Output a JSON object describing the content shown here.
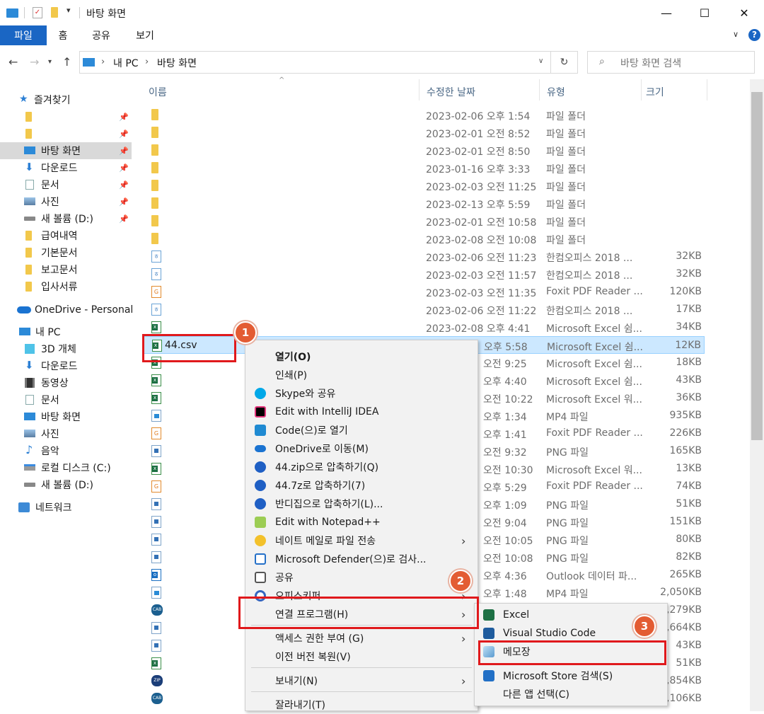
{
  "window": {
    "title": "바탕 화면",
    "controls": {
      "minimize": "—",
      "maximize": "☐",
      "close": "✕"
    }
  },
  "ribbon": {
    "tabs": [
      {
        "label": "파일",
        "active": true
      },
      {
        "label": "홈"
      },
      {
        "label": "공유"
      },
      {
        "label": "보기"
      }
    ],
    "help": "?"
  },
  "address": {
    "path": [
      "내 PC",
      "바탕 화면"
    ],
    "search_placeholder": "바탕 화면 검색"
  },
  "sidebar": {
    "quick_access": "즐겨찾기",
    "items": [
      {
        "label": "",
        "icon": "folder-icon",
        "pinned": true
      },
      {
        "label": "",
        "icon": "folder-icon",
        "pinned": true
      },
      {
        "label": "바탕 화면",
        "icon": "desktop-icon",
        "pinned": true,
        "selected": true
      },
      {
        "label": "다운로드",
        "icon": "download-icon",
        "pinned": true
      },
      {
        "label": "문서",
        "icon": "document-icon",
        "pinned": true
      },
      {
        "label": "사진",
        "icon": "pictures-icon",
        "pinned": true
      },
      {
        "label": "새 볼륨 (D:)",
        "icon": "drive-icon",
        "pinned": true
      },
      {
        "label": "급여내역",
        "icon": "folder-icon"
      },
      {
        "label": "기본문서",
        "icon": "folder-icon"
      },
      {
        "label": "보고문서",
        "icon": "folder-icon"
      },
      {
        "label": "입사서류",
        "icon": "folder-icon"
      }
    ],
    "onedrive": "OneDrive - Personal",
    "this_pc": "내 PC",
    "pc_items": [
      {
        "label": "3D 개체",
        "icon": "3d-objects-icon"
      },
      {
        "label": "다운로드",
        "icon": "download-icon"
      },
      {
        "label": "동영상",
        "icon": "video-icon"
      },
      {
        "label": "문서",
        "icon": "document-icon"
      },
      {
        "label": "바탕 화면",
        "icon": "desktop-icon"
      },
      {
        "label": "사진",
        "icon": "pictures-icon"
      },
      {
        "label": "음악",
        "icon": "music-icon"
      },
      {
        "label": "로컬 디스크 (C:)",
        "icon": "local-disk-icon"
      },
      {
        "label": "새 볼륨 (D:)",
        "icon": "drive-icon"
      }
    ],
    "network": "네트워크"
  },
  "filelist": {
    "columns": {
      "name": "이름",
      "date": "수정한 날짜",
      "type": "유형",
      "size": "크기"
    },
    "rows": [
      {
        "icon": "folder",
        "name": "",
        "date": "2023-02-06 오후 1:54",
        "type": "파일 폴더",
        "size": ""
      },
      {
        "icon": "folder",
        "name": "",
        "date": "2023-02-01 오전 8:52",
        "type": "파일 폴더",
        "size": ""
      },
      {
        "icon": "folder",
        "name": "",
        "date": "2023-02-01 오전 8:50",
        "type": "파일 폴더",
        "size": ""
      },
      {
        "icon": "folder",
        "name": "",
        "date": "2023-01-16 오후 3:33",
        "type": "파일 폴더",
        "size": ""
      },
      {
        "icon": "folder",
        "name": "",
        "date": "2023-02-03 오전 11:25",
        "type": "파일 폴더",
        "size": ""
      },
      {
        "icon": "folder",
        "name": "",
        "date": "2023-02-13 오후 5:59",
        "type": "파일 폴더",
        "size": ""
      },
      {
        "icon": "folder",
        "name": "",
        "date": "2023-02-01 오전 10:58",
        "type": "파일 폴더",
        "size": ""
      },
      {
        "icon": "folder",
        "name": "",
        "date": "2023-02-08 오전 10:08",
        "type": "파일 폴더",
        "size": ""
      },
      {
        "icon": "hwp",
        "name": "",
        "date": "2023-02-06 오전 11:23",
        "type": "한컴오피스 2018 ...",
        "size": "32KB"
      },
      {
        "icon": "hwp",
        "name": "",
        "date": "2023-02-03 오전 11:57",
        "type": "한컴오피스 2018 ...",
        "size": "32KB"
      },
      {
        "icon": "pdf",
        "name": "",
        "date": "2023-02-03 오전 11:35",
        "type": "Foxit PDF Reader ...",
        "size": "120KB"
      },
      {
        "icon": "hwp",
        "name": "",
        "date": "2023-02-06 오전 11:22",
        "type": "한컴오피스 2018 ...",
        "size": "17KB"
      },
      {
        "icon": "xl",
        "name": "",
        "date": "2023-02-08 오후 4:41",
        "type": "Microsoft Excel 쉼...",
        "size": "34KB"
      },
      {
        "icon": "xl",
        "name": "44.csv",
        "date": "",
        "date_tail": "오후 5:58",
        "type": "Microsoft Excel 쉼...",
        "size": "12KB",
        "selected": true
      },
      {
        "icon": "xl",
        "name": "",
        "date": "",
        "date_tail": "오전 9:25",
        "type": "Microsoft Excel 쉼...",
        "size": "18KB"
      },
      {
        "icon": "xl",
        "name": "",
        "date": "",
        "date_tail": "오후 4:40",
        "type": "Microsoft Excel 쉼...",
        "size": "43KB"
      },
      {
        "icon": "xl",
        "name": "",
        "date": "",
        "date_tail": "오전 10:22",
        "type": "Microsoft Excel 워...",
        "size": "36KB"
      },
      {
        "icon": "mp4",
        "name": "",
        "date": "",
        "date_tail": "오후 1:34",
        "type": "MP4 파일",
        "size": "935KB"
      },
      {
        "icon": "pdf",
        "name": "",
        "date": "",
        "date_tail": "오후 1:41",
        "type": "Foxit PDF Reader ...",
        "size": "226KB"
      },
      {
        "icon": "png",
        "name": "",
        "date": "",
        "date_tail": "오전 9:32",
        "type": "PNG 파일",
        "size": "165KB"
      },
      {
        "icon": "xl",
        "name": "",
        "date": "",
        "date_tail": "오전 10:30",
        "type": "Microsoft Excel 워...",
        "size": "13KB"
      },
      {
        "icon": "pdf",
        "name": "",
        "date": "",
        "date_tail": "오후 5:29",
        "type": "Foxit PDF Reader ...",
        "size": "74KB"
      },
      {
        "icon": "png",
        "name": "",
        "date": "",
        "date_tail": "오후 1:09",
        "type": "PNG 파일",
        "size": "51KB"
      },
      {
        "icon": "png",
        "name": "",
        "date": "",
        "date_tail": "오전 9:04",
        "type": "PNG 파일",
        "size": "151KB"
      },
      {
        "icon": "png",
        "name": "",
        "date": "",
        "date_tail": "오전 10:05",
        "type": "PNG 파일",
        "size": "80KB"
      },
      {
        "icon": "png",
        "name": "",
        "date": "",
        "date_tail": "오전 10:08",
        "type": "PNG 파일",
        "size": "82KB"
      },
      {
        "icon": "outlook",
        "name": "",
        "date": "",
        "date_tail": "오후 4:36",
        "type": "Outlook 데이터 파...",
        "size": "265KB"
      },
      {
        "icon": "mp4",
        "name": "",
        "date": "",
        "date_tail": "오후 1:48",
        "type": "MP4 파일",
        "size": "2,050KB"
      },
      {
        "icon": "cab",
        "name": "",
        "date": "",
        "date_tail": "",
        "type": "",
        "size": ",279KB"
      },
      {
        "icon": "png",
        "name": "",
        "date": "",
        "date_tail": "",
        "type": "",
        "size": ",664KB"
      },
      {
        "icon": "png",
        "name": "",
        "date": "",
        "date_tail": "",
        "type": "",
        "size": "43KB"
      },
      {
        "icon": "xl",
        "name": "",
        "date": "",
        "date_tail": "",
        "type": "",
        "size": "51KB"
      },
      {
        "icon": "zip",
        "name": "",
        "date": "",
        "date_tail": "",
        "type": "",
        "size": ",854KB"
      },
      {
        "icon": "cab",
        "name": "",
        "date": "",
        "date_tail": "",
        "type": "",
        "size": ",106KB"
      }
    ]
  },
  "context_menu": {
    "items": [
      {
        "label": "열기(O)",
        "bold": true,
        "icon": ""
      },
      {
        "label": "인쇄(P)",
        "icon": ""
      },
      {
        "label": "Skype와 공유",
        "icon": "skype-icon"
      },
      {
        "label": "Edit with IntelliJ IDEA",
        "icon": "intellij-icon"
      },
      {
        "label": "Code(으)로 열기",
        "icon": "vscode-icon"
      },
      {
        "label": "OneDrive로 이동(M)",
        "icon": "onedrive-icon"
      },
      {
        "label": "44.zip으로 압축하기(Q)",
        "icon": "bandizip-icon"
      },
      {
        "label": "44.7z로 압축하기(7)",
        "icon": "bandizip-icon"
      },
      {
        "label": "반디집으로 압축하기(L)...",
        "icon": "bandizip-icon"
      },
      {
        "label": "Edit with Notepad++",
        "icon": "notepadpp-icon"
      },
      {
        "label": "네이트 메일로 파일 전송",
        "icon": "nate-icon",
        "submenu": true
      },
      {
        "label": "Microsoft Defender(으)로 검사...",
        "icon": "defender-icon"
      },
      {
        "label": "공유",
        "icon": "share-icon"
      },
      {
        "label": "오피스키퍼",
        "icon": "officekeeper-icon",
        "submenu": true
      },
      {
        "label": "연결 프로그램(H)",
        "icon": "",
        "submenu": true
      },
      {
        "label": "액세스 권한 부여 (G)",
        "icon": "",
        "submenu": true
      },
      {
        "label": "이전 버전 복원(V)",
        "icon": ""
      },
      {
        "label": "보내기(N)",
        "icon": "",
        "submenu": true
      },
      {
        "label": "잘라내기(T)",
        "icon": ""
      }
    ]
  },
  "open_with_menu": {
    "items": [
      {
        "label": "Excel",
        "icon": "excel-icon"
      },
      {
        "label": "Visual Studio Code",
        "icon": "vscode-icon"
      },
      {
        "label": "메모장",
        "icon": "notepad-icon"
      },
      {
        "label": "Microsoft Store 검색(S)",
        "icon": "store-icon"
      },
      {
        "label": "다른 앱 선택(C)",
        "icon": ""
      }
    ]
  },
  "annotations": {
    "badge1": "1",
    "badge2": "2",
    "badge3": "3"
  },
  "colors": {
    "accent": "#1a66c4",
    "highlight": "#e0191c",
    "badge": "#e35c33",
    "selection": "#cce8ff"
  }
}
